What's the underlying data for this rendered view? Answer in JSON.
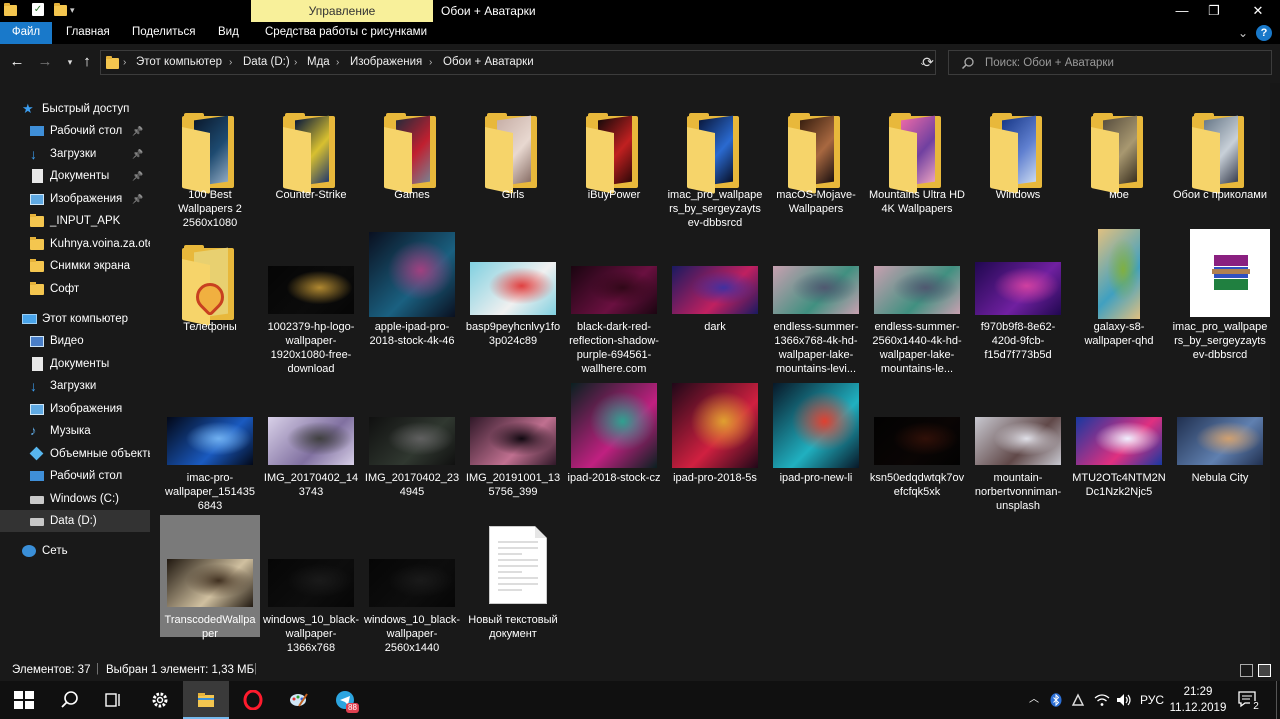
{
  "window": {
    "manage_tab": "Управление",
    "title": "Обои + Аватарки",
    "minimize": "—",
    "maximize": "❐",
    "close": "✕"
  },
  "ribbon": {
    "tabs": [
      "Файл",
      "Главная",
      "Поделиться",
      "Вид",
      "Средства работы с рисунками"
    ],
    "active_tab": "Файл",
    "help": "?",
    "accent": "#1979ca"
  },
  "address": {
    "crumbs": [
      "Этот компьютер",
      "Data (D:)",
      "Мда",
      "Изображения",
      "Обои + Аватарки"
    ],
    "search_placeholder": "Поиск: Обои + Аватарки"
  },
  "sidebar": {
    "items": [
      {
        "label": "Быстрый доступ",
        "icon": "star-icon",
        "pinned": false
      },
      {
        "label": "Рабочий стол",
        "icon": "desktop-icon",
        "pinned": true
      },
      {
        "label": "Загрузки",
        "icon": "download-icon",
        "pinned": true
      },
      {
        "label": "Документы",
        "icon": "document-icon",
        "pinned": true
      },
      {
        "label": "Изображения",
        "icon": "pictures-icon",
        "pinned": true
      },
      {
        "label": "_INPUT_APK",
        "icon": "folder-icon",
        "pinned": false
      },
      {
        "label": "Kuhnya.voina.za.ote",
        "icon": "folder-icon",
        "pinned": false
      },
      {
        "label": "Снимки экрана",
        "icon": "folder-icon",
        "pinned": false
      },
      {
        "label": "Софт",
        "icon": "folder-icon",
        "pinned": false
      },
      {
        "label": "Этот компьютер",
        "icon": "computer-icon",
        "pinned": false
      },
      {
        "label": "Видео",
        "icon": "video-icon",
        "pinned": false
      },
      {
        "label": "Документы",
        "icon": "document-icon",
        "pinned": false
      },
      {
        "label": "Загрузки",
        "icon": "download-icon",
        "pinned": false
      },
      {
        "label": "Изображения",
        "icon": "pictures-icon",
        "pinned": false
      },
      {
        "label": "Музыка",
        "icon": "music-icon",
        "pinned": false
      },
      {
        "label": "Объемные объекты",
        "icon": "3d-objects-icon",
        "pinned": false
      },
      {
        "label": "Рабочий стол",
        "icon": "desktop-icon",
        "pinned": false
      },
      {
        "label": "Windows (C:)",
        "icon": "drive-icon",
        "pinned": false
      },
      {
        "label": "Data (D:)",
        "icon": "drive-icon",
        "pinned": false,
        "selected": true
      },
      {
        "label": "Сеть",
        "icon": "network-icon",
        "pinned": false
      }
    ]
  },
  "files": [
    {
      "name": "100 Best Wallpapers 2 2560x1080",
      "kind": "folder",
      "colors": [
        "#0b1a2e",
        "#1d4a70",
        "#8fa8c0"
      ]
    },
    {
      "name": "Counter-Strike",
      "kind": "folder",
      "colors": [
        "#0a1a3a",
        "#d8c030",
        "#243a6a"
      ]
    },
    {
      "name": "Games",
      "kind": "folder",
      "colors": [
        "#2a2a3a",
        "#c02030",
        "#7a8090"
      ]
    },
    {
      "name": "Girls",
      "kind": "folder",
      "colors": [
        "#c8b0a8",
        "#e8d8d0",
        "#8a7068"
      ]
    },
    {
      "name": "iBuyPower",
      "kind": "folder",
      "colors": [
        "#1a0a0a",
        "#c02020",
        "#300808"
      ]
    },
    {
      "name": "imac_pro_wallpapers_by_sergeyzaytsev-dbbsrcd",
      "kind": "folder",
      "colors": [
        "#0a1a40",
        "#2a6ad0",
        "#081028"
      ]
    },
    {
      "name": "macOS-Mojave-Wallpapers",
      "kind": "folder",
      "colors": [
        "#3a2010",
        "#a86840",
        "#1a1010"
      ]
    },
    {
      "name": "Mountains Ultra HD 4K Wallpapers",
      "kind": "folder",
      "colors": [
        "#e868a8",
        "#7040a0",
        "#e8a0c0"
      ]
    },
    {
      "name": "Windows",
      "kind": "folder",
      "colors": [
        "#1a3a8a",
        "#6080d0",
        "#c8d8f0"
      ]
    },
    {
      "name": "мое",
      "kind": "folder",
      "colors": [
        "#5a5040",
        "#a89870",
        "#3a3020"
      ]
    },
    {
      "name": "Обои с приколами",
      "kind": "folder",
      "colors": [
        "#6a7a8a",
        "#c8d0d8",
        "#3a4050"
      ]
    },
    {
      "name": "Телефоны",
      "kind": "folder-pizza",
      "colors": [
        "#c84020",
        "#f0b040",
        "#e8d070"
      ]
    },
    {
      "name": "1002379-hp-logo-wallpaper-1920x1080-free-download",
      "kind": "image-land",
      "colors": [
        "#050505",
        "#0b0b0b",
        "#b08830"
      ]
    },
    {
      "name": "apple-ipad-pro-2018-stock-4k-46",
      "kind": "image-sq",
      "colors": [
        "#0a1020",
        "#1a6080",
        "#a04080"
      ]
    },
    {
      "name": "basp9peyhcnlvy1fo3p024c89",
      "kind": "image-small",
      "colors": [
        "#80d0e0",
        "#f0f0f0",
        "#e04040"
      ]
    },
    {
      "name": "black-dark-red-reflection-shadow-purple-694561-wallhere.com",
      "kind": "image-land",
      "colors": [
        "#1a0510",
        "#6a1040",
        "#300818"
      ]
    },
    {
      "name": "dark",
      "kind": "image-land",
      "colors": [
        "#1a1a60",
        "#c02060",
        "#4030a0"
      ]
    },
    {
      "name": "endless-summer-1366x768-4k-hd-wallpaper-lake-mountains-levi...",
      "kind": "image-land",
      "colors": [
        "#c8a0b0",
        "#409080",
        "#505870"
      ]
    },
    {
      "name": "endless-summer-2560x1440-4k-hd-wallpaper-lake-mountains-le...",
      "kind": "image-land",
      "colors": [
        "#c8a0b0",
        "#409080",
        "#505870"
      ]
    },
    {
      "name": "f970b9f8-8e62-420d-9fcb-f15d7f773b5d",
      "kind": "image-small",
      "colors": [
        "#200850",
        "#7020a0",
        "#d040a0"
      ]
    },
    {
      "name": "galaxy-s8-wallpaper-qhd",
      "kind": "image-port",
      "colors": [
        "#e0c080",
        "#40a0c0",
        "#80b040"
      ]
    },
    {
      "name": "imac_pro_wallpapers_by_sergeyzaytsev-dbbsrcd",
      "kind": "rar",
      "colors": [
        "#8a2080",
        "#3050c0",
        "#208040"
      ]
    },
    {
      "name": "imac-pro-wallpaper_1514356843",
      "kind": "image-land",
      "colors": [
        "#020818",
        "#1a5ac0",
        "#70b0f0"
      ]
    },
    {
      "name": "IMG_20170402_143743",
      "kind": "image-land",
      "colors": [
        "#d8d0e8",
        "#8070a0",
        "#404040"
      ]
    },
    {
      "name": "IMG_20170402_234945",
      "kind": "image-land",
      "colors": [
        "#101010",
        "#303830",
        "#606060"
      ]
    },
    {
      "name": "IMG_20191001_135756_399",
      "kind": "image-land",
      "colors": [
        "#301828",
        "#c07090",
        "#100810"
      ]
    },
    {
      "name": "ipad-2018-stock-cz",
      "kind": "image-sq",
      "colors": [
        "#0a2020",
        "#c02080",
        "#30a090"
      ]
    },
    {
      "name": "ipad-pro-2018-5s",
      "kind": "image-sq",
      "colors": [
        "#200818",
        "#d02040",
        "#e0a030"
      ]
    },
    {
      "name": "ipad-pro-new-li",
      "kind": "image-sq",
      "colors": [
        "#081828",
        "#20b0c0",
        "#e04030"
      ]
    },
    {
      "name": "ksn50edqdwtqk7ovefcfqk5xk",
      "kind": "image-land",
      "colors": [
        "#020202",
        "#0a0504",
        "#301008"
      ]
    },
    {
      "name": "mountain-norbertvonniman-unsplash",
      "kind": "image-land",
      "colors": [
        "#c8c8d0",
        "#604848",
        "#e0e0e8"
      ]
    },
    {
      "name": "MTU2OTc4NTM2NDc1Nzk2Njc5",
      "kind": "image-land",
      "colors": [
        "#1838a0",
        "#e03080",
        "#f0f0ff"
      ]
    },
    {
      "name": "Nebula City",
      "kind": "image-land",
      "colors": [
        "#203050",
        "#6080b0",
        "#d0a070"
      ]
    },
    {
      "name": "TranscodedWallpaper",
      "kind": "image-land",
      "colors": [
        "#201810",
        "#d0c0a0",
        "#403020"
      ],
      "selected": true
    },
    {
      "name": "windows_10_black-wallpaper-1366x768",
      "kind": "image-land",
      "colors": [
        "#060606",
        "#0d0d0d",
        "#1a1a1a"
      ]
    },
    {
      "name": "windows_10_black-wallpaper-2560x1440",
      "kind": "image-land",
      "colors": [
        "#060606",
        "#0d0d0d",
        "#1a1a1a"
      ]
    },
    {
      "name": "Новый текстовый документ",
      "kind": "text-doc",
      "colors": [
        "#ffffff",
        "#dddddd",
        "#cccccc"
      ]
    }
  ],
  "status": {
    "count": "Элементов: 37",
    "selection": "Выбран 1 элемент: 1,33 МБ"
  },
  "taskbar": {
    "apps": [
      "start-icon",
      "search-icon",
      "task-view-icon",
      "settings-icon",
      "explorer-icon",
      "opera-icon",
      "paint-icon",
      "telegram-icon"
    ],
    "telegram_badge": "88",
    "language": "РУС",
    "time": "21:29",
    "date": "11.12.2019",
    "notifications": "2"
  }
}
